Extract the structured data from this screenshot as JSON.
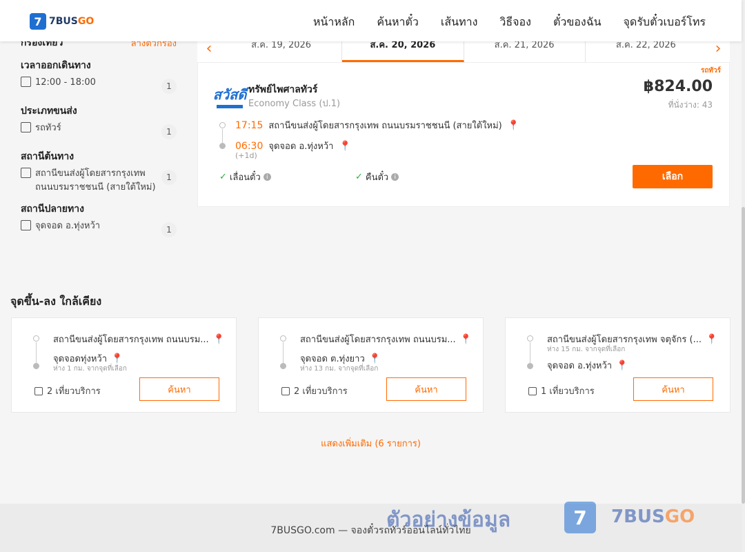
{
  "header": {
    "logo_mark": "7",
    "logo_text_a": "7BUS",
    "logo_text_b": "GO",
    "nav": [
      "หน้าหลัก",
      "ค้นหาตั๋ว",
      "เส้นทาง",
      "วิธีจอง",
      "ตั๋วของฉัน",
      "จุดรับตั๋วเบอร์โทร"
    ]
  },
  "sidebar": {
    "title": "กรองเที่ยว",
    "clear": "ล้างตัวกรอง",
    "groups": [
      {
        "title": "เวลาออกเดินทาง",
        "options": [
          {
            "label": "12:00 - 18:00",
            "count": "1"
          }
        ]
      },
      {
        "title": "ประเภทขนส่ง",
        "options": [
          {
            "label": "รถทัวร์",
            "count": "1"
          }
        ]
      },
      {
        "title": "สถานีต้นทาง",
        "options": [
          {
            "label": "สถานีขนส่งผู้โดยสารกรุงเทพ ถนนบรมราชชนนี (สายใต้ใหม่)",
            "count": "1"
          }
        ]
      },
      {
        "title": "สถานีปลายทาง",
        "options": [
          {
            "label": "จุดจอด อ.ทุ่งหว้า",
            "count": "1"
          }
        ]
      }
    ]
  },
  "dates": {
    "prev": "‹",
    "next": "›",
    "tabs": [
      "ส.ค. 19, 2026",
      "ส.ค. 20, 2026",
      "ส.ค. 21, 2026",
      "ส.ค. 22, 2026"
    ],
    "active_index": 1
  },
  "trip": {
    "vehicle_type": "รถทัวร์",
    "operator_logo": "สวัสดี",
    "operator": "ทรัพย์ไพศาลทัวร์",
    "class": "Economy Class (ป.1)",
    "price": "฿824.00",
    "seats": "ที่นั่งว่าง: 43",
    "depart_time": "17:15",
    "depart_station": "สถานีขนส่งผู้โดยสารกรุงเทพ ถนนบรมราชชนนี (สายใต้ใหม่)",
    "arrive_time": "06:30",
    "arrive_station": "จุดจอด อ.ทุ่งหว้า",
    "next_day": "(+1d)",
    "policy_change": "เลื่อนตั๋ว",
    "policy_refund": "คืนตั๋ว",
    "select": "เลือก"
  },
  "nearby": {
    "title": "จุดขึ้น-ลง ใกล้เคียง",
    "cards": [
      {
        "from": "สถานีขนส่งผู้โดยสารกรุงเทพ ถนนบรม...",
        "to": "จุดจอดทุ่งหว้า",
        "distance": "ห่าง 1 กม. จากจุดที่เลือก",
        "trips": "2 เที่ยวบริการ",
        "search": "ค้นหา"
      },
      {
        "from": "สถานีขนส่งผู้โดยสารกรุงเทพ ถนนบรม...",
        "to": "จุดจอด ต.ทุ่งยาว",
        "distance": "ห่าง 13 กม. จากจุดที่เลือก",
        "trips": "2 เที่ยวบริการ",
        "search": "ค้นหา"
      },
      {
        "from": "สถานีขนส่งผู้โดยสารกรุงเทพ จตุจักร (...",
        "from_distance": "ห่าง 15 กม. จากจุดที่เลือก",
        "to": "จุดจอด อ.ทุ่งหว้า",
        "trips": "1 เที่ยวบริการ",
        "search": "ค้นหา"
      }
    ],
    "show_more": "แสดงเพิ่มเติม (6 รายการ)"
  },
  "footer": {
    "text": "7BUSGO.com — จองตั๋วรถทัวร์ออนไลน์ทั่วไทย",
    "watermark": "ตัวอย่างข้อมูล",
    "wm_mark": "7",
    "wm_brand_a": "7BUS",
    "wm_brand_b": "GO"
  },
  "colors": {
    "accent": "#ff6a00",
    "brand": "#1f6fd1",
    "pin": "#e0262b",
    "check": "#2eaa44"
  }
}
